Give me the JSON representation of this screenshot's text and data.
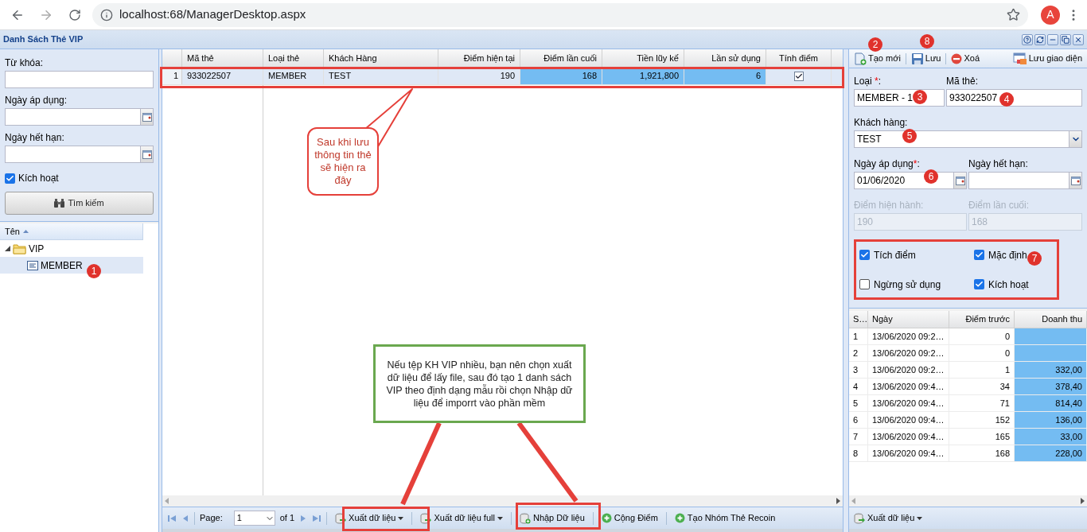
{
  "browser": {
    "url": "localhost:68/ManagerDesktop.aspx",
    "avatar": "A"
  },
  "window": {
    "title": "Danh Sách Thẻ VIP"
  },
  "filters": {
    "fields": [
      {
        "label": "Từ khóa:",
        "kind": "text"
      },
      {
        "label": "Ngày áp dụng:",
        "kind": "date"
      },
      {
        "label": "Ngày hết hạn:",
        "kind": "date"
      }
    ],
    "active": {
      "label": "Kích hoạt",
      "checked": true
    },
    "search_button": "Tìm kiếm"
  },
  "tree": {
    "column": "Tên",
    "items": [
      {
        "label": "VIP",
        "kind": "folder",
        "expanded": true,
        "selected": false,
        "children": [
          {
            "label": "MEMBER",
            "kind": "card",
            "selected": true
          }
        ]
      }
    ]
  },
  "grid": {
    "columns": [
      {
        "label": "Mã thẻ",
        "kind": "text",
        "highlight": false
      },
      {
        "label": "Loại thẻ",
        "kind": "text",
        "highlight": false
      },
      {
        "label": "Khách Hàng",
        "kind": "text",
        "highlight": false
      },
      {
        "label": "Điểm hiện tại",
        "kind": "number",
        "highlight": false
      },
      {
        "label": "Điểm lần cuối",
        "kind": "number",
        "highlight": true
      },
      {
        "label": "Tiền lũy kế",
        "kind": "number",
        "highlight": true
      },
      {
        "label": "Lần sử dụng",
        "kind": "number",
        "highlight": true
      },
      {
        "label": "Tính điểm",
        "kind": "check",
        "highlight": false
      }
    ],
    "rows": [
      {
        "number": "1",
        "selected": true,
        "cells": [
          "933022507",
          "MEMBER",
          "TEST",
          "190",
          "168",
          "1,921,800",
          "6",
          true
        ]
      }
    ]
  },
  "pager": {
    "label": "Page:",
    "page": "1",
    "of": "of 1",
    "tools": [
      {
        "label": "Xuất dữ liệu",
        "kind": "export",
        "dropdown": true
      },
      {
        "label": "Xuất dữ liệu full",
        "kind": "export",
        "dropdown": true
      },
      {
        "label": "Nhập Dữ liệu",
        "kind": "import",
        "dropdown": false
      },
      {
        "label": "Cộng Điểm",
        "kind": "add",
        "dropdown": false
      },
      {
        "label": "Tạo Nhóm Thẻ Recoin",
        "kind": "add",
        "dropdown": false
      }
    ]
  },
  "editor": {
    "toolbar": [
      {
        "label": "Tạo mới",
        "kind": "new"
      },
      {
        "label": "Lưu",
        "kind": "save"
      },
      {
        "label": "Xoá",
        "kind": "delete"
      },
      {
        "label": "Lưu giao diện",
        "kind": "layout"
      }
    ],
    "loai": {
      "label": "Loại ",
      "required_mark": "*",
      "suffix": ":",
      "value": "MEMBER - 1"
    },
    "ma_the": {
      "label": "Mã thẻ:",
      "value": "933022507"
    },
    "khach_hang": {
      "label": "Khách hàng:",
      "value": "TEST"
    },
    "ngay_ap_dung": {
      "label": "Ngày áp dụng",
      "required_mark": "*",
      "suffix": ":",
      "value": "01/06/2020"
    },
    "ngay_het_han": {
      "label": "Ngày hết hạn:"
    },
    "diem_hien_hanh": {
      "label": "Điểm hiện hành:",
      "value": "190",
      "disabled": true
    },
    "diem_lan_cuoi": {
      "label": "Điểm lần cuối:",
      "value": "168",
      "disabled": true
    },
    "options": [
      {
        "label": "Tích điểm",
        "checked": true
      },
      {
        "label": "Mặc định",
        "checked": true
      },
      {
        "label": "Ngừng sử dụng",
        "checked": false
      },
      {
        "label": "Kích hoạt",
        "checked": true
      }
    ]
  },
  "history": {
    "columns": [
      {
        "label": "S…",
        "kind": "text",
        "highlight": false
      },
      {
        "label": "Ngày",
        "kind": "text",
        "highlight": false
      },
      {
        "label": "Điểm trước",
        "kind": "number",
        "highlight": false
      },
      {
        "label": "Doanh thu",
        "kind": "number",
        "highlight": true
      }
    ],
    "rows": [
      {
        "cells": [
          "1",
          "13/06/2020 09:2…",
          "0"
        ]
      },
      {
        "cells": [
          "2",
          "13/06/2020 09:2…",
          "0"
        ]
      },
      {
        "cells": [
          "3",
          "13/06/2020 09:2…",
          "1",
          "332,00"
        ]
      },
      {
        "cells": [
          "4",
          "13/06/2020 09:4…",
          "34",
          "378,40"
        ]
      },
      {
        "cells": [
          "5",
          "13/06/2020 09:4…",
          "71",
          "814,40"
        ]
      },
      {
        "cells": [
          "6",
          "13/06/2020 09:4…",
          "152",
          "136,00"
        ]
      },
      {
        "cells": [
          "7",
          "13/06/2020 09:4…",
          "165",
          "33,00"
        ]
      },
      {
        "cells": [
          "8",
          "13/06/2020 09:4…",
          "168",
          "228,00"
        ]
      }
    ],
    "tool": {
      "label": "Xuất dữ liệu",
      "kind": "export",
      "dropdown": true
    }
  },
  "annotations": {
    "badges": [
      {
        "number": "1"
      },
      {
        "number": "2"
      },
      {
        "number": "8"
      },
      {
        "number": "3"
      },
      {
        "number": "4"
      },
      {
        "number": "5"
      },
      {
        "number": "6"
      },
      {
        "number": "7"
      }
    ],
    "notes": [
      {
        "kind": "bubble",
        "text": "Sau khi lưu thông tin thẻ sẽ hiện ra đây"
      },
      {
        "kind": "box",
        "text": "Nếu tệp KH VIP nhiều, bạn nên chọn xuất dữ liệu để lấy file, sau đó tạo 1 danh sách VIP theo định dạng mẫu rồi chọn Nhập dữ liệu để imporrt vào phần mềm"
      }
    ]
  }
}
